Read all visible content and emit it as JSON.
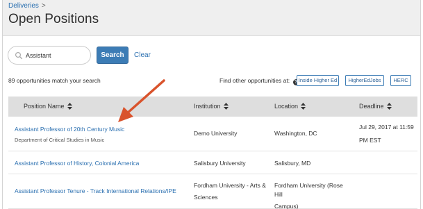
{
  "breadcrumb": {
    "parent": "Deliveries",
    "separator": ">"
  },
  "page": {
    "title": "Open Positions"
  },
  "search": {
    "value": "Assistant",
    "button_label": "Search",
    "clear_label": "Clear"
  },
  "results": {
    "count_text": "89 opportunities match your search"
  },
  "external": {
    "label": "Find other opportunities at:",
    "help_icon": "question-circle-icon",
    "buttons": [
      "Inside Higher Ed",
      "HigherEdJobs",
      "HERC"
    ]
  },
  "table": {
    "headers": {
      "position": "Position Name",
      "institution": "Institution",
      "location": "Location",
      "deadline": "Deadline"
    },
    "rows": [
      {
        "title": "Assistant Professor of 20th Century Music",
        "department": "Department of Critical Studies in Music",
        "institution": "Demo University",
        "location": "Washington, DC",
        "deadline_line1": "Jul 29, 2017 at 11:59",
        "deadline_line2": "PM EST"
      },
      {
        "title": "Assistant Professor of History, Colonial America",
        "institution": "Salisbury University",
        "location": "Salisbury, MD"
      },
      {
        "title": "Assistant Professor Tenure - Track International Relations/IPE",
        "institution_line1": "Fordham University - Arts &",
        "institution_line2": "Sciences",
        "location_line1": "Fordham University (Rose Hill",
        "location_line2": "Campus)"
      }
    ]
  },
  "colors": {
    "link": "#2a6fb0",
    "primary_button": "#3c7cb5",
    "header_bg": "#efefef",
    "table_header_bg": "#dedede",
    "annotation_arrow": "#d9532c"
  }
}
